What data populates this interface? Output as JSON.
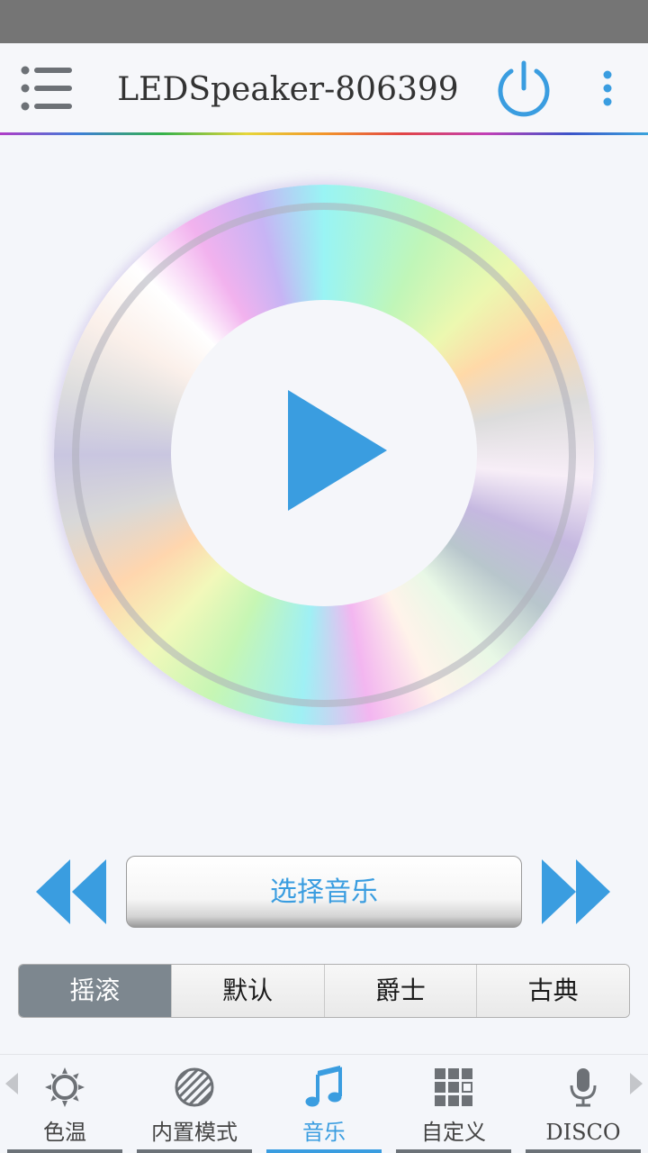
{
  "header": {
    "title": "LEDSpeaker-806399",
    "menu_icon": "list-menu-icon",
    "power_icon": "power-icon",
    "more_icon": "more-vertical-icon",
    "accent_color": "#3a9de0"
  },
  "player": {
    "play_icon": "play-icon",
    "prev_icon": "rewind-icon",
    "next_icon": "fast-forward-icon",
    "select_music_label": "选择音乐"
  },
  "genres": {
    "items": [
      {
        "label": "摇滚",
        "active": true
      },
      {
        "label": "默认",
        "active": false
      },
      {
        "label": "爵士",
        "active": false
      },
      {
        "label": "古典",
        "active": false
      }
    ]
  },
  "bottom_nav": {
    "items": [
      {
        "label": "色温",
        "icon": "sun-icon",
        "active": false
      },
      {
        "label": "内置模式",
        "icon": "striped-circle-icon",
        "active": false
      },
      {
        "label": "音乐",
        "icon": "music-note-icon",
        "active": true
      },
      {
        "label": "自定义",
        "icon": "grid-icon",
        "active": false
      },
      {
        "label": "DISCO",
        "icon": "microphone-icon",
        "active": false
      }
    ]
  }
}
